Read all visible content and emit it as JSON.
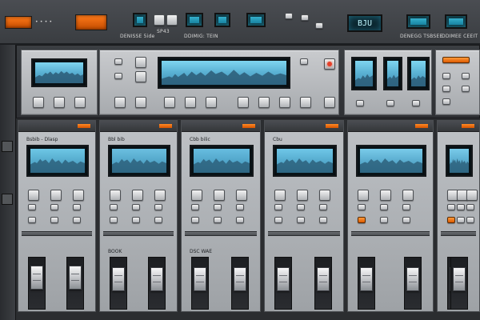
{
  "top_bar": {
    "display_text": "BJU",
    "labels": {
      "left": "DENISSE 5ide",
      "left2": "SP43",
      "mid": "DDIMIG: TEIN",
      "right1": "DENEGG TSBSEE",
      "right2": "DDIMEE CEEIT"
    }
  },
  "upper_panel": {
    "section1_label": "",
    "section1_buttons": [
      "",
      "",
      ""
    ],
    "section3_label": "",
    "section3_buttons": [
      "",
      "",
      ""
    ]
  },
  "channels": [
    {
      "name": "ch1",
      "header": "Bsbib - Dlasp",
      "header2": "",
      "bottom_label": "",
      "fader_levels": [
        0.15,
        0.15
      ],
      "orange": false,
      "screen_color": "#6ec7e6"
    },
    {
      "name": "ch2",
      "header": "Bbl bib",
      "header2": "",
      "bottom_label": "BOOK",
      "fader_levels": [
        0.18,
        0.18
      ],
      "orange": false,
      "screen_color": "#6bbfe0"
    },
    {
      "name": "ch3",
      "header": "Cbb bilic",
      "header2": "",
      "bottom_label": "DSC WAE",
      "fader_levels": [
        0.18,
        0.18
      ],
      "orange": false,
      "screen_color": "#67bde0"
    },
    {
      "name": "ch4",
      "header": "Cbu",
      "header2": "",
      "bottom_label": "",
      "fader_levels": [
        0.18,
        0.18
      ],
      "orange": false,
      "screen_color": "#6fc7e8"
    },
    {
      "name": "ch5",
      "header": "",
      "header2": "",
      "bottom_label": "",
      "fader_levels": [
        0.18,
        0.18
      ],
      "orange": true,
      "screen_color": "#79cbea"
    },
    {
      "name": "ch6",
      "header": "",
      "header2": "",
      "bottom_label": "",
      "fader_levels": [
        0.18,
        0.18
      ],
      "orange": true,
      "screen_color": "#79cbea"
    }
  ],
  "icons": {
    "gear": "gear-icon",
    "power": "power-icon"
  },
  "colors": {
    "accent": "#ff7a1a",
    "lcd": "#5cc6e8",
    "panel": "#b6b9bd"
  }
}
